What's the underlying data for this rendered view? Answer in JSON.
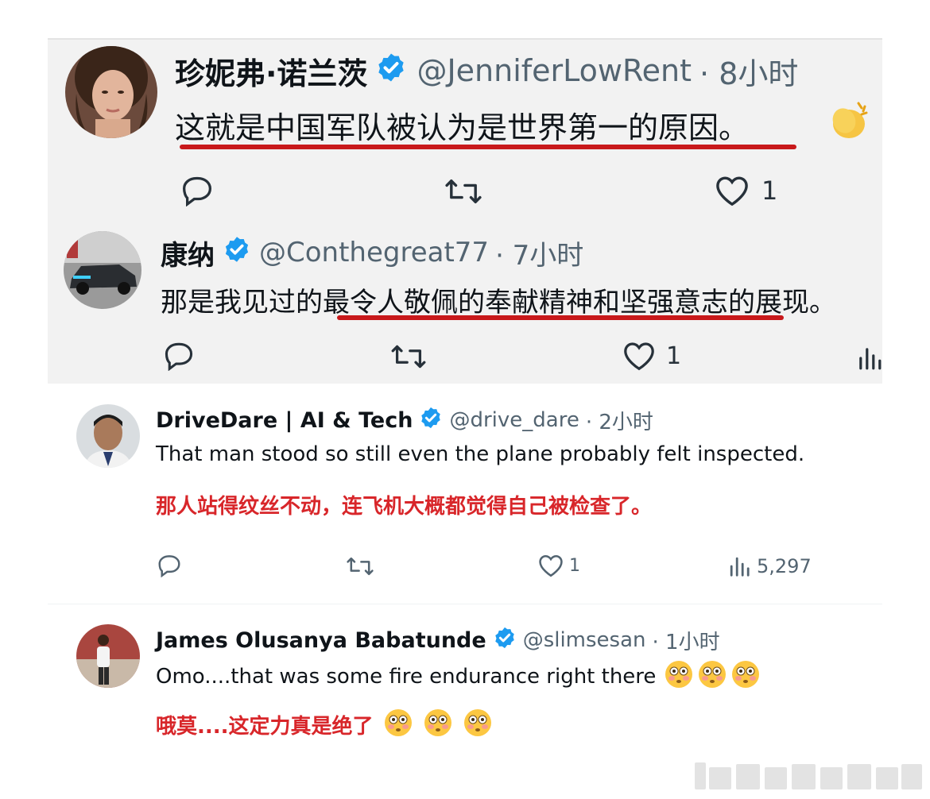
{
  "tweets": [
    {
      "name": "珍妮弗·诺兰茨",
      "handle": "@JenniferLowRent",
      "time": "· 8小时",
      "text": "这就是中国军队被认为是世界第一的原因。",
      "likes": "1"
    },
    {
      "name": "康纳",
      "handle": "@Conthegreat77",
      "time": "· 7小时",
      "text": "那是我见过的最令人敬佩的奉献精神和坚强意志的展现。",
      "likes": "1"
    },
    {
      "name": "DriveDare | AI & Tech",
      "handle": "@drive_dare",
      "time": "· 2小时",
      "text": "That man stood so still even the plane probably felt inspected.",
      "translation": "那人站得纹丝不动，连飞机大概都觉得自己被检查了。",
      "likes": "1",
      "views": "5,297"
    },
    {
      "name": "James Olusanya Babatunde",
      "handle": "@slimsesan",
      "time": "· 1小时",
      "text": "Omo....that was some fire endurance right there",
      "translation": "哦莫....这定力真是绝了"
    }
  ],
  "colors": {
    "verified": "#1d9bf0",
    "underline": "#c8191b",
    "translation": "#d8262a",
    "screenshot_bg": "#f2f2f2"
  }
}
